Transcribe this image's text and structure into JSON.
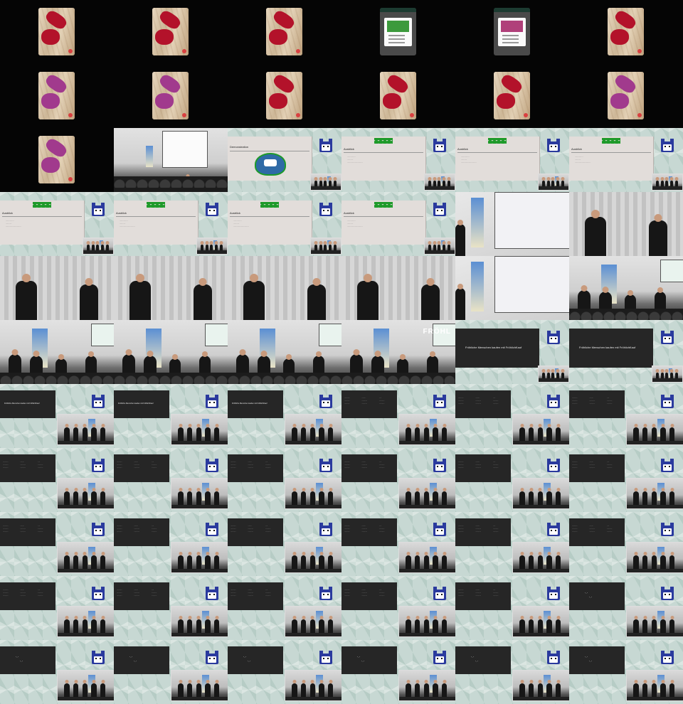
{
  "grid": {
    "columns": 6,
    "rows": 11
  },
  "slide_text": {
    "demo_title": "Demonstration",
    "ausblick_title": "Ausblick",
    "ausblick_bullets": [
      "..............",
      "..........",
      ".........................."
    ],
    "frohlich_slogan": "Fröhliche Menschen kaufen mit FröhlichKauf",
    "frohlich_banner": "FRÖHL",
    "table_cells": [
      "...........",
      "........",
      ".....",
      "...........",
      "...........",
      "...........",
      "...........",
      "...........",
      "..........."
    ],
    "quote_line1": "\"...\"",
    "quote_line2": "\"...\""
  },
  "colors": {
    "blot_red": "#b3122a",
    "blot_magenta": "#a13a8d",
    "dialog_green": "#3c9a3c",
    "dialog_pink": "#b0407a",
    "slide_bg": "#e2ddda",
    "slide_dark": "#262626",
    "mascot_blue": "#2a3a9e",
    "pattern_bg": "#c7d8d3"
  },
  "cells": [
    {
      "type": "phone-floor",
      "blot": "red"
    },
    {
      "type": "phone-floor",
      "blot": "red"
    },
    {
      "type": "phone-floor",
      "blot": "red"
    },
    {
      "type": "phone-dialog",
      "blot": "green"
    },
    {
      "type": "phone-dialog",
      "blot": "pink"
    },
    {
      "type": "phone-floor",
      "blot": "red"
    },
    {
      "type": "phone-floor",
      "blot": "magenta"
    },
    {
      "type": "phone-floor",
      "blot": "magenta"
    },
    {
      "type": "phone-floor",
      "blot": "red"
    },
    {
      "type": "phone-floor",
      "blot": "red"
    },
    {
      "type": "phone-floor",
      "blot": "red"
    },
    {
      "type": "phone-floor",
      "blot": "magenta"
    },
    {
      "type": "phone-floor",
      "blot": "magenta"
    },
    {
      "type": "venue"
    },
    {
      "type": "slide-demo"
    },
    {
      "type": "slide-ausblick"
    },
    {
      "type": "slide-ausblick"
    },
    {
      "type": "slide-ausblick"
    },
    {
      "type": "slide-ausblick"
    },
    {
      "type": "slide-ausblick"
    },
    {
      "type": "slide-ausblick"
    },
    {
      "type": "slide-ausblick"
    },
    {
      "type": "projector"
    },
    {
      "type": "duo"
    },
    {
      "type": "duo"
    },
    {
      "type": "duo"
    },
    {
      "type": "duo"
    },
    {
      "type": "duo"
    },
    {
      "type": "projector"
    },
    {
      "type": "group"
    },
    {
      "type": "group"
    },
    {
      "type": "group"
    },
    {
      "type": "group"
    },
    {
      "type": "group-banner"
    },
    {
      "type": "slide-frohlich"
    },
    {
      "type": "slide-frohlich"
    },
    {
      "type": "slide-dark-slogan"
    },
    {
      "type": "slide-dark-slogan"
    },
    {
      "type": "slide-dark-slogan"
    },
    {
      "type": "slide-dark-table"
    },
    {
      "type": "slide-dark-table"
    },
    {
      "type": "slide-dark-table"
    },
    {
      "type": "slide-dark-table"
    },
    {
      "type": "slide-dark-table"
    },
    {
      "type": "slide-dark-table"
    },
    {
      "type": "slide-dark-table"
    },
    {
      "type": "slide-dark-table"
    },
    {
      "type": "slide-dark-table"
    },
    {
      "type": "slide-dark-table"
    },
    {
      "type": "slide-dark-table"
    },
    {
      "type": "slide-dark-table"
    },
    {
      "type": "slide-dark-table"
    },
    {
      "type": "slide-dark-table"
    },
    {
      "type": "slide-dark-table"
    },
    {
      "type": "slide-dark-table"
    },
    {
      "type": "slide-dark-table"
    },
    {
      "type": "slide-dark-table"
    },
    {
      "type": "slide-dark-table"
    },
    {
      "type": "slide-dark-table"
    },
    {
      "type": "slide-dark-quote"
    },
    {
      "type": "slide-dark-quote"
    },
    {
      "type": "slide-dark-quote"
    },
    {
      "type": "slide-dark-quote"
    },
    {
      "type": "slide-dark-quote"
    },
    {
      "type": "slide-dark-quote"
    },
    {
      "type": "slide-dark-quote"
    }
  ]
}
